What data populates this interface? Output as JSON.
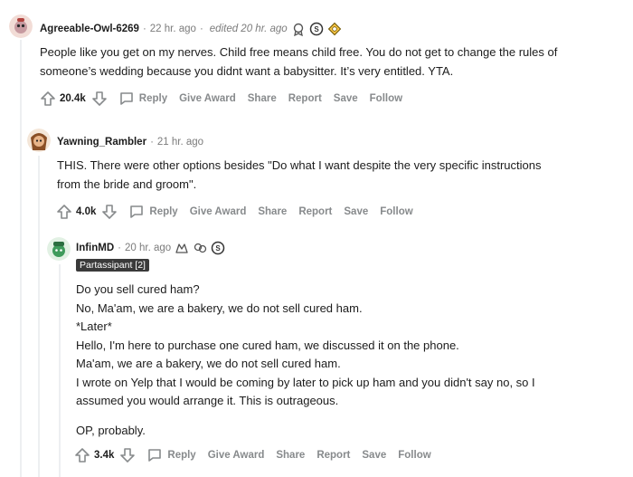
{
  "comments": [
    {
      "username": "Agreeable-Owl-6269",
      "time": "22 hr. ago",
      "edited": "edited 20 hr. ago",
      "body": [
        "People like you get on my nerves. Child free means child free. You do not get to change the rules of",
        "someone’s wedding because you didnt want a babysitter. It’s very entitled. YTA."
      ],
      "score": "20.4k"
    },
    {
      "username": "Yawning_Rambler",
      "time": "21 hr. ago",
      "body": [
        "THIS. There were other options besides \"Do what I want despite the very specific instructions",
        "from the bride and groom\"."
      ],
      "score": "4.0k"
    },
    {
      "username": "InfinMD",
      "time": "20 hr. ago",
      "flair": "Partassipant [2]",
      "body": [
        "Do you sell cured ham?",
        "No, Ma'am, we are a bakery, we do not sell cured ham.",
        "*Later*",
        "Hello, I'm here to purchase one cured ham, we discussed it on the phone.",
        "Ma'am, we are a bakery, we do not sell cured ham.",
        "I wrote on Yelp that I would be coming by later to pick up ham and you didn't say no, so I",
        "assumed you would arrange it. This is outrageous.",
        "",
        "OP, probably."
      ],
      "score": "3.4k"
    }
  ],
  "actions": {
    "reply": "Reply",
    "give_award": "Give Award",
    "share": "Share",
    "report": "Report",
    "save": "Save",
    "follow": "Follow"
  },
  "icons": [
    "upvote-icon",
    "downvote-icon",
    "reply-bubble-icon",
    "award-icon",
    "silver-award-icon"
  ],
  "colors": {
    "meta_gray": "#7c7c7c",
    "action_gray": "#878a8c",
    "flair_bg": "#3a3a3a",
    "thread_line": "#edeff1"
  }
}
